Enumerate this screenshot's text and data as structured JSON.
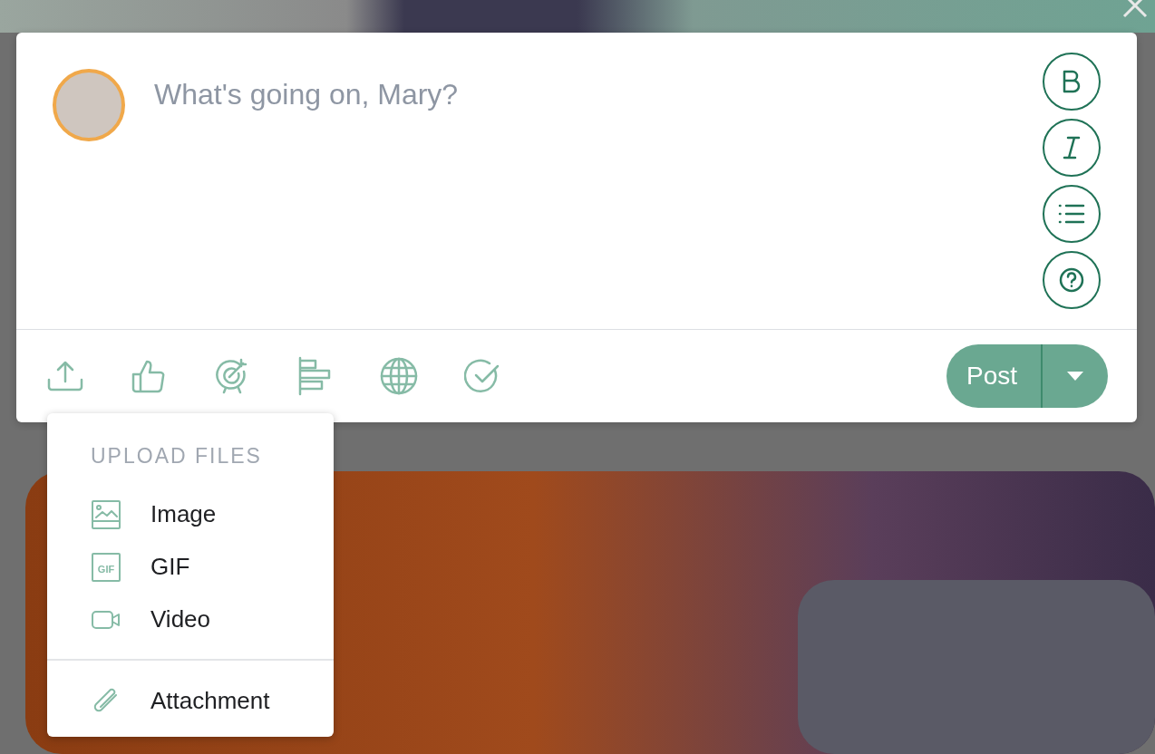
{
  "composer": {
    "placeholder": "What's going on, Mary?",
    "format_buttons": [
      {
        "kind": "bold"
      },
      {
        "kind": "italic"
      },
      {
        "kind": "list"
      },
      {
        "kind": "help"
      }
    ],
    "toolbar": [
      {
        "kind": "upload"
      },
      {
        "kind": "like"
      },
      {
        "kind": "target"
      },
      {
        "kind": "chart"
      },
      {
        "kind": "globe"
      },
      {
        "kind": "check"
      }
    ],
    "post_button": {
      "label": "Post"
    }
  },
  "upload_menu": {
    "heading": "UPLOAD FILES",
    "items": [
      {
        "kind": "image",
        "label": "Image"
      },
      {
        "kind": "gif",
        "label": "GIF",
        "icon_text": "GIF"
      },
      {
        "kind": "video",
        "label": "Video"
      },
      {
        "kind": "attachment",
        "label": "Attachment",
        "separated": true
      }
    ]
  }
}
